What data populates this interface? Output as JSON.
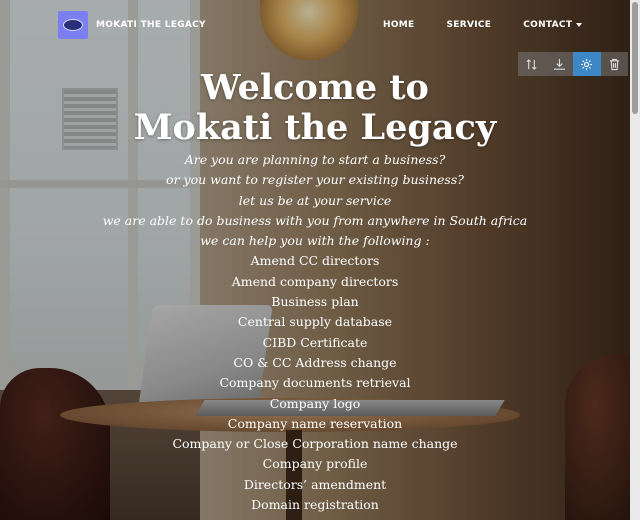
{
  "navbar": {
    "brand_name": "MOKATI THE LEGACY",
    "links": [
      {
        "label": "HOME"
      },
      {
        "label": "SERVICE"
      },
      {
        "label": "CONTACT"
      }
    ]
  },
  "toolbar": {
    "icons": [
      "sort-icon",
      "download-icon",
      "gear-icon",
      "trash-icon"
    ],
    "active_color": "#3d87c7"
  },
  "hero": {
    "title_line1": "Welcome to",
    "title_line2": "Mokati the Legacy",
    "intro_lines": [
      "Are you are planning to start a business?",
      "or you want to register your existing business?",
      "let us be at your service",
      "we are able to do business with you from anywhere in South africa",
      "we can help you with the following :"
    ],
    "services": [
      "Amend CC directors",
      "Amend company directors",
      "Business plan",
      "Central supply database",
      "CIBD Certificate",
      "CO & CC Address change",
      "Company documents retrieval",
      "Company logo",
      "Company name reservation",
      "Company or Close Corporation name change",
      "Company profile",
      "Directors’ amendment",
      "Domain registration"
    ]
  }
}
